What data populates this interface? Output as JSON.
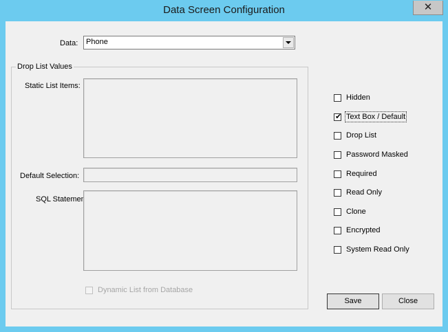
{
  "window": {
    "title": "Data Screen Configuration",
    "close_label": "✕"
  },
  "data_field": {
    "label": "Data:",
    "value": "Phone",
    "icon": "chevron-down-icon"
  },
  "drop_list": {
    "group_label": "Drop List Values",
    "static_label": "Static List Items:",
    "default_label": "Default Selection:",
    "sql_label": "SQL Statement:",
    "dynamic_label": "Dynamic List from Database",
    "dynamic_checked": false,
    "dynamic_enabled": false
  },
  "options": [
    {
      "label": "Hidden",
      "checked": false
    },
    {
      "label": "Text Box / Default",
      "checked": true
    },
    {
      "label": "Drop List",
      "checked": false
    },
    {
      "label": "Password Masked",
      "checked": false
    },
    {
      "label": "Required",
      "checked": false
    },
    {
      "label": "Read Only",
      "checked": false
    },
    {
      "label": "Clone",
      "checked": false
    },
    {
      "label": "Encrypted",
      "checked": false
    },
    {
      "label": "System Read Only",
      "checked": false
    }
  ],
  "buttons": {
    "save": "Save",
    "close": "Close"
  },
  "colors": {
    "titlebar": "#6ccbef",
    "client": "#f0f0f0"
  }
}
